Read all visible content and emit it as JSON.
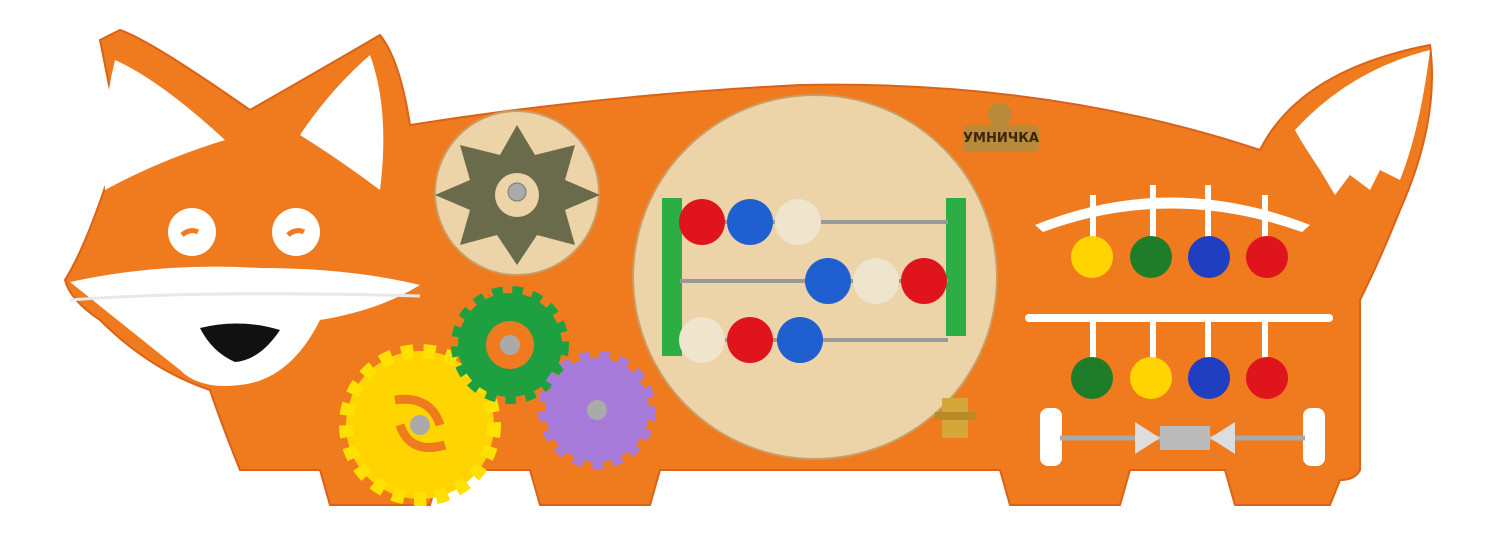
{
  "product": {
    "logo_text": "УМНИЧКА",
    "colors": {
      "board": "#f07a1e",
      "white": "#ffffff",
      "wood": "#ecd3a8",
      "red": "#e0141c",
      "blue": "#1f5fd0",
      "green": "#1f7d2a",
      "yellow": "#ffd400",
      "purple": "#a57ad8",
      "cream": "#efe4cc"
    }
  }
}
